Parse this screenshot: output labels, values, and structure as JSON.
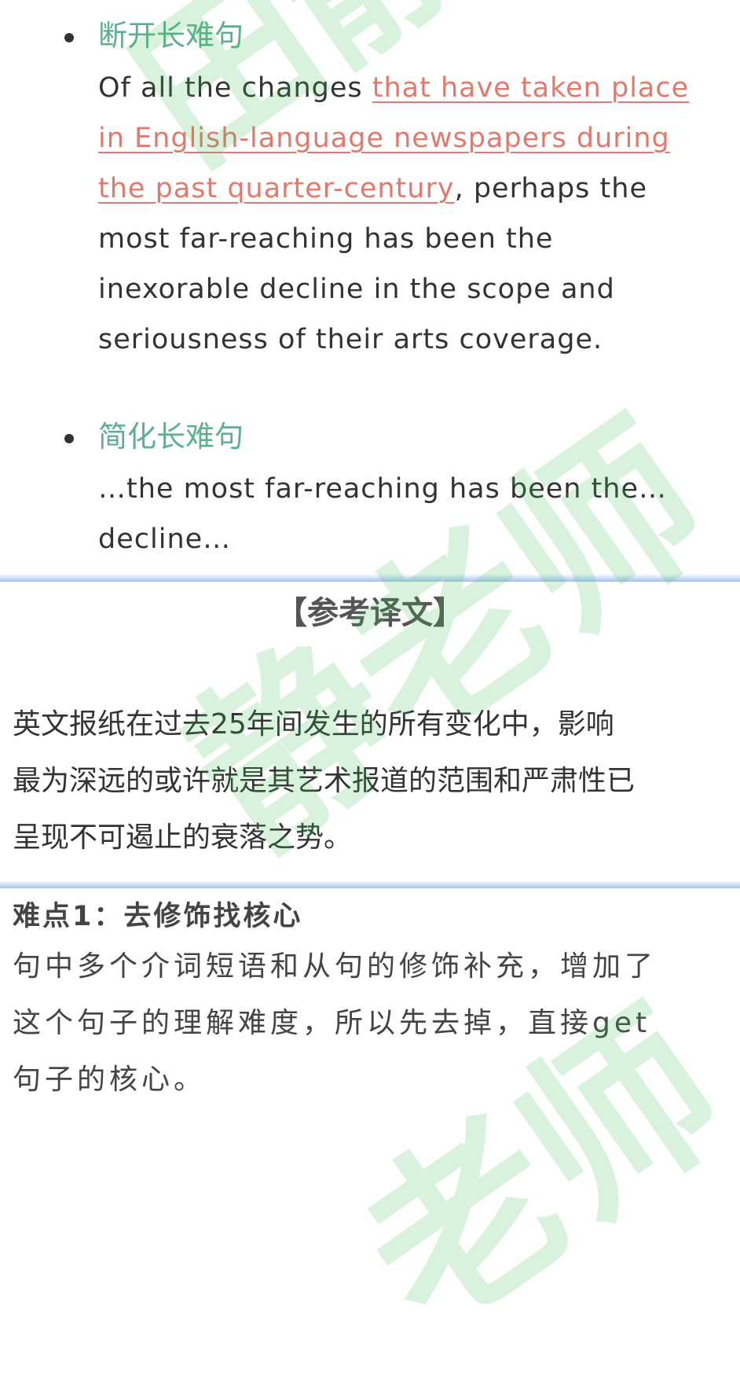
{
  "simplify_section": {
    "item1": {
      "title": "断开长难句",
      "lines": [
        {
          "pre": "Of all the changes ",
          "hl": "that have taken place",
          "post": ""
        },
        {
          "pre": "",
          "hl": "in English-language newspapers during",
          "post": ""
        },
        {
          "pre": "",
          "hl": "the past quarter-century",
          "post": ", perhaps the"
        },
        {
          "pre": "most far-reaching has been the",
          "hl": "",
          "post": ""
        },
        {
          "pre": "inexorable decline in the scope and",
          "hl": "",
          "post": ""
        },
        {
          "pre": "seriousness of their arts coverage.",
          "hl": "",
          "post": ""
        }
      ]
    },
    "item2": {
      "title": "简化长难句",
      "lines": [
        "…the most far-reaching has been the…",
        "decline…"
      ]
    }
  },
  "reference": {
    "title": "【参考译文】",
    "lines": [
      "英文报纸在过去25年间发生的所有变化中，影响",
      "最为深远的或许就是其艺术报道的范围和严肃性已",
      "呈现不可遏止的衰落之势。"
    ]
  },
  "difficulty": {
    "title": "难点1：去修饰找核心",
    "lines": [
      "句中多个介词短语和从句的修饰补充，增加了",
      "这个句子的理解难度，所以先去掉，直接get",
      "句子的核心。"
    ]
  },
  "colors": {
    "heading_green": "#5fae8c",
    "highlight_red": "#e07a6e",
    "divider_blue": "#5a8ce6",
    "watermark_green": "#3cbe5a"
  }
}
